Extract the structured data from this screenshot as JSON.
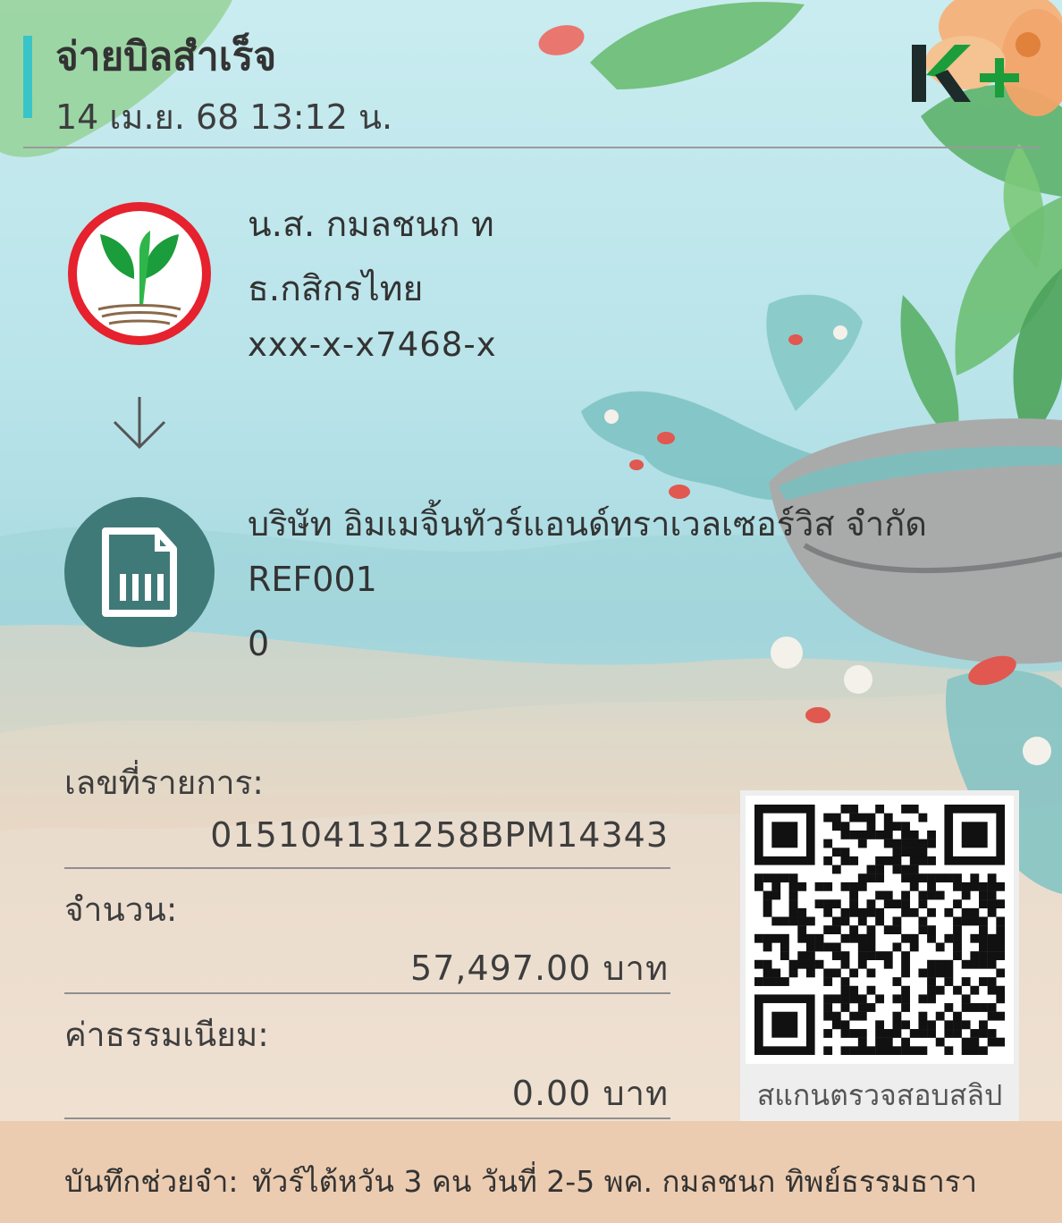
{
  "header": {
    "title": "จ่ายบิลสำเร็จ",
    "datetime": "14 เม.ย. 68  13:12 น.",
    "logo_icon": "kplus-logo-icon",
    "accent_color": "#39c4c7"
  },
  "sender": {
    "name": "น.ส. กมลชนก ท",
    "bank": "ธ.กสิกรไทย",
    "account": "xxx-x-x7468-x",
    "logo_icon": "kasikornbank-logo-icon"
  },
  "transfer_direction_icon": "arrow-down-icon",
  "payee": {
    "name": "บริษัท อิมเมจิ้นทัวร์แอนด์ทราเวลเซอร์วิส จำกัด",
    "ref1": "REF001",
    "ref2": "0",
    "icon": "bill-document-icon",
    "icon_color": "#407a78"
  },
  "details": {
    "transaction_id_label": "เลขที่รายการ:",
    "transaction_id": "015104131258BPM14343",
    "amount_label": "จำนวน:",
    "amount": "57,497.00 บาท",
    "fee_label": "ค่าธรรมเนียม:",
    "fee": "0.00 บาท"
  },
  "qr": {
    "caption": "สแกนตรวจสอบสลิป",
    "icon": "qr-code-icon"
  },
  "memo": {
    "label": "บันทึกช่วยจำ:",
    "value": "ทัวร์ไต้หวัน 3 คน วันที่ 2-5 พค. กมลชนก ทิพย์ธรรมธารา"
  },
  "colors": {
    "brand_green": "#1a9d3a",
    "kbank_red": "#e5222d",
    "memo_bg": "#ecccb0"
  }
}
